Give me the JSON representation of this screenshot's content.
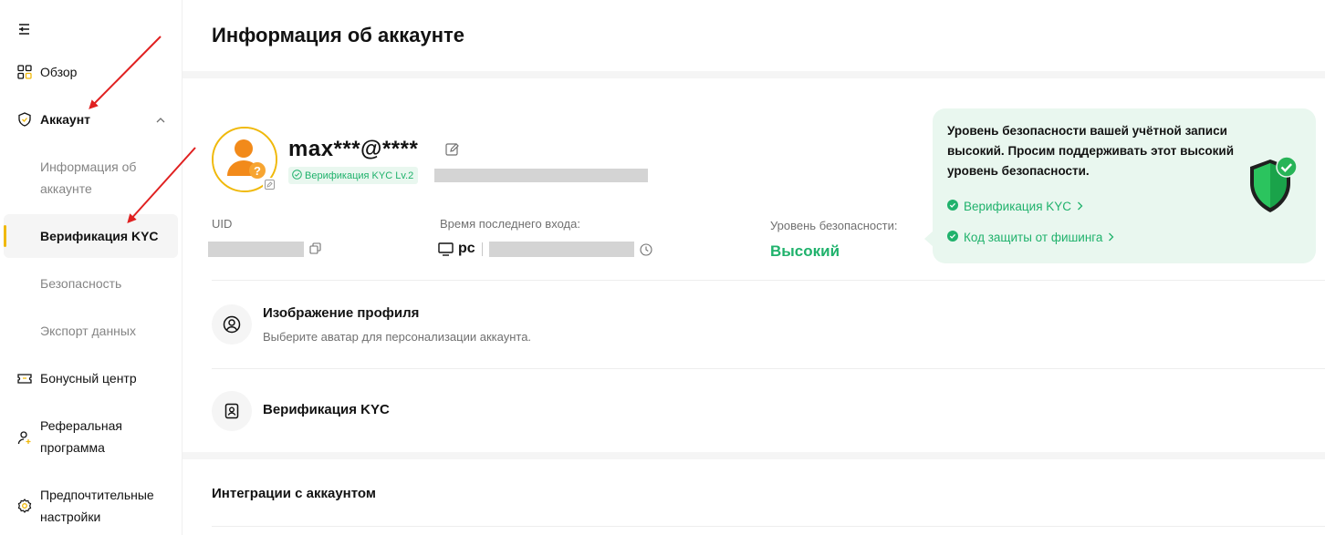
{
  "sidebar": {
    "collapse_icon": "collapse-menu-icon",
    "items": [
      {
        "label": "Обзор",
        "icon": "grid-icon"
      },
      {
        "label": "Аккаунт",
        "icon": "shield-check-icon"
      },
      {
        "label": "Информация об аккаунте"
      },
      {
        "label": "Верификация KYC"
      },
      {
        "label": "Безопасность"
      },
      {
        "label": "Экспорт данных"
      },
      {
        "label": "Бонусный центр",
        "icon": "ticket-icon"
      },
      {
        "label": "Реферальная программа",
        "icon": "user-plus-icon"
      },
      {
        "label": "Предпочтительные настройки",
        "icon": "gear-icon"
      }
    ]
  },
  "main": {
    "title": "Информация об аккаунте",
    "profile": {
      "username": "max***@****",
      "kyc_badge": "Верификация KYC Lv.2",
      "uid_label": "UID",
      "last_login_label": "Время последнего входа:",
      "device": "pc",
      "security_label": "Уровень безопасности:",
      "security_value": "Высокий"
    },
    "security_card": {
      "text": "Уровень безопасности вашей учётной записи высокий. Просим поддерживать этот высокий уровень безопасности.",
      "link_kyc": "Верификация KYC",
      "link_phishing": "Код защиты от фишинга"
    },
    "rows": [
      {
        "title": "Изображение профиля",
        "subtitle": "Выберите аватар для персонализации аккаунта."
      },
      {
        "title": "Верификация KYC"
      }
    ],
    "integrations_title": "Интеграции с аккаунтом"
  },
  "colors": {
    "accent": "#f0b90b",
    "success": "#20b26c",
    "annotation_arrow": "#e02020"
  }
}
